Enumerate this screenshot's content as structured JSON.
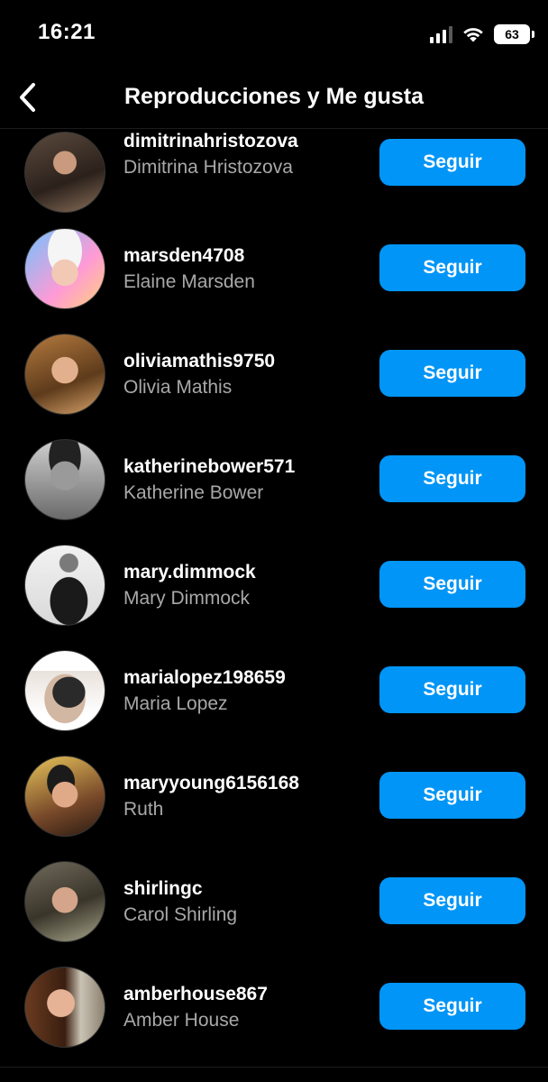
{
  "status_bar": {
    "time": "16:21",
    "battery": "63"
  },
  "header": {
    "title": "Reproducciones y Me gusta"
  },
  "colors": {
    "background": "#000000",
    "accent": "#0095f6",
    "secondary_text": "#a8a8a8"
  },
  "icons": {
    "back": "chevron-left-icon",
    "signal": "signal-icon",
    "wifi": "wifi-icon",
    "battery": "battery-icon"
  },
  "users": [
    {
      "username": "dimitrinahristozova",
      "full_name": "Dimitrina Hristozova",
      "button": "Seguir"
    },
    {
      "username": "marsden4708",
      "full_name": "Elaine Marsden",
      "button": "Seguir"
    },
    {
      "username": "oliviamathis9750",
      "full_name": "Olivia Mathis",
      "button": "Seguir"
    },
    {
      "username": "katherinebower571",
      "full_name": "Katherine Bower",
      "button": "Seguir"
    },
    {
      "username": "mary.dimmock",
      "full_name": "Mary Dimmock",
      "button": "Seguir"
    },
    {
      "username": "marialopez198659",
      "full_name": "Maria Lopez",
      "button": "Seguir"
    },
    {
      "username": "maryyoung6156168",
      "full_name": "Ruth",
      "button": "Seguir"
    },
    {
      "username": "shirlingc",
      "full_name": "Carol Shirling",
      "button": "Seguir"
    },
    {
      "username": "amberhouse867",
      "full_name": "Amber House",
      "button": "Seguir"
    }
  ]
}
